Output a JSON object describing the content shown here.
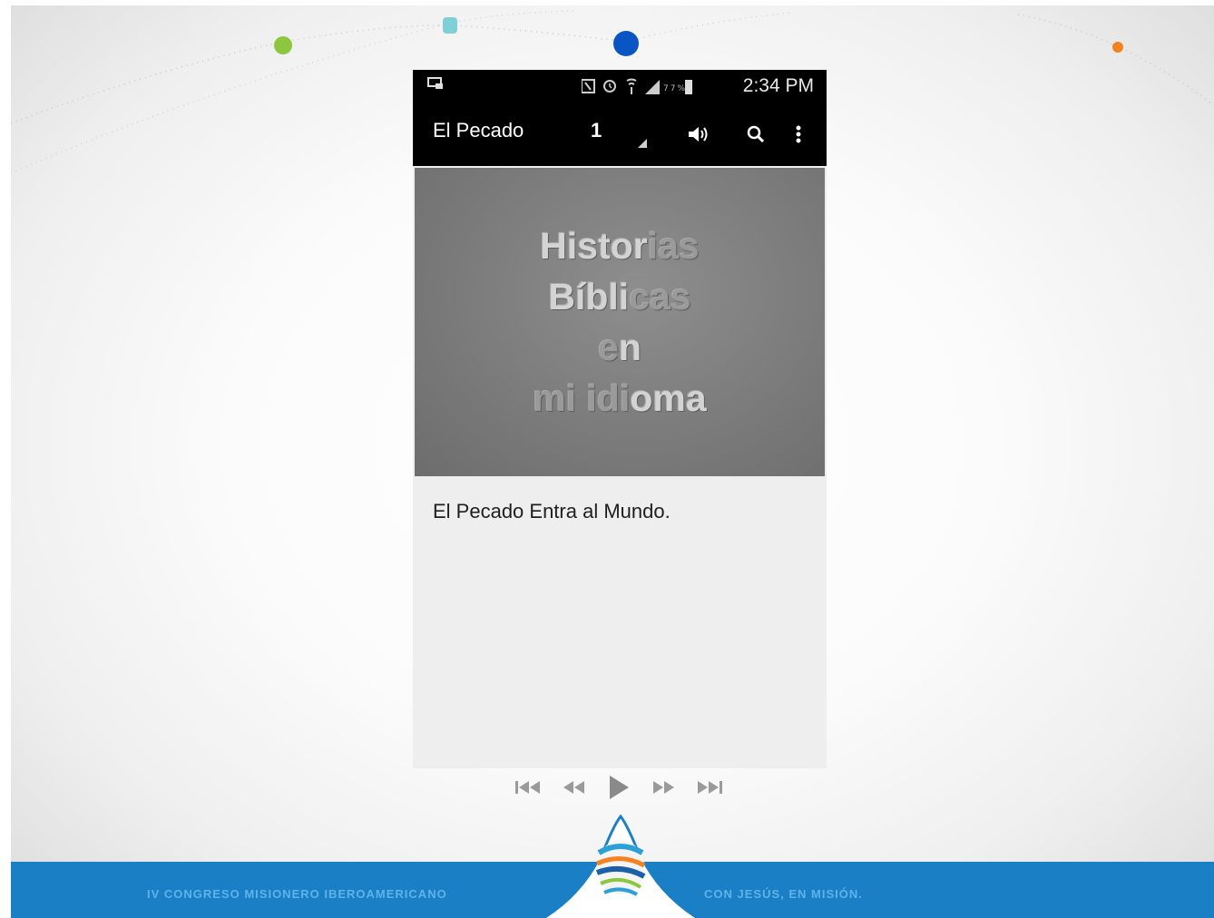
{
  "status_bar": {
    "time": "2:34 PM",
    "left_icon": "screen-cast-icon",
    "icons": [
      "nfc-icon",
      "alarm-icon",
      "wifi-icon",
      "signal-icon",
      "battery-icon"
    ]
  },
  "action_bar": {
    "title": "El Pecado",
    "spinner_value": "1",
    "icons": [
      "volume-icon",
      "search-icon",
      "overflow-menu-icon"
    ]
  },
  "cover": {
    "line1_a": "Histor",
    "line1_b": "ias",
    "line2_a": "Bíbli",
    "line2_b": "cas",
    "line3_a": "e",
    "line3_b": "n",
    "line4_a": "mi idi",
    "line4_b": "oma"
  },
  "content": {
    "text": "El Pecado Entra al Mundo."
  },
  "player": {
    "controls": [
      "skip-previous-icon",
      "rewind-icon",
      "play-icon",
      "fast-forward-icon",
      "skip-next-icon"
    ]
  },
  "banner": {
    "left_text": "IV CONGRESO MISIONERO IBEROAMERICANO",
    "right_text": "CON JESÚS, EN MISIÓN."
  },
  "colors": {
    "banner_blue": "#1b7fc6",
    "dot_green": "#8dc63f",
    "dot_teal": "#7ecfd6",
    "dot_blue": "#0a55c4",
    "dot_orange": "#f58220"
  }
}
